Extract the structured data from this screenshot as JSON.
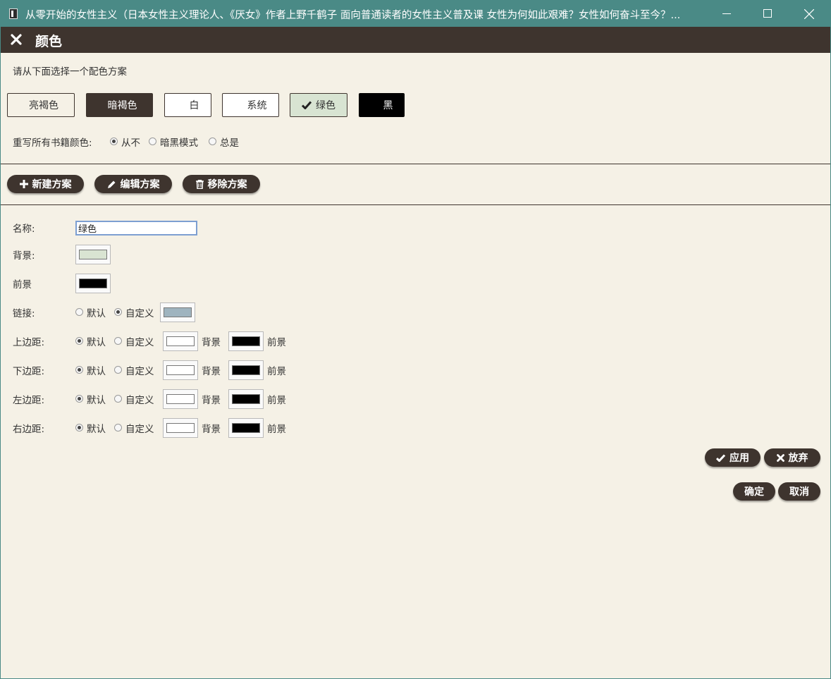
{
  "window": {
    "title": "从零开始的女性主义（日本女性主义理论人、《厌女》作者上野千鹤子 面向普通读者的女性主义普及课 女性为何如此艰难？女性如何奋斗至今？..."
  },
  "dialog": {
    "title": "颜色"
  },
  "schemes": {
    "prompt": "请从下面选择一个配色方案",
    "items": [
      {
        "label": "亮褐色",
        "bg": "#f5f1e6",
        "fg": "#333333"
      },
      {
        "label": "暗褐色",
        "bg": "#3e342e",
        "fg": "#ffffff"
      },
      {
        "label": "白",
        "bg": "#ffffff",
        "fg": "#333333"
      },
      {
        "label": "系统",
        "bg": "#ffffff",
        "fg": "#333333"
      },
      {
        "label": "绿色",
        "bg": "#d8e4d2",
        "fg": "#333333",
        "selected": true
      },
      {
        "label": "黑",
        "bg": "#000000",
        "fg": "#ffffff"
      }
    ]
  },
  "override": {
    "label": "重写所有书籍颜色:",
    "options": [
      {
        "label": "从不",
        "checked": true
      },
      {
        "label": "暗黑模式",
        "checked": false
      },
      {
        "label": "总是",
        "checked": false
      }
    ]
  },
  "scheme_actions": {
    "new_label": "新建方案",
    "edit_label": "编辑方案",
    "remove_label": "移除方案"
  },
  "form": {
    "name_label": "名称:",
    "name_value": "绿色",
    "background_label": "背景:",
    "background_color": "#d9e4d2",
    "foreground_label": "前景",
    "foreground_color": "#000000",
    "link_label": "链接:",
    "link_color": "#9fb4bf",
    "default_label": "默认",
    "custom_label": "自定义",
    "bg_word": "背景",
    "fg_word": "前景",
    "margins": [
      {
        "label": "上边距:",
        "bg": "#ffffff",
        "fg": "#000000"
      },
      {
        "label": "下边距:",
        "bg": "#ffffff",
        "fg": "#000000"
      },
      {
        "label": "左边距:",
        "bg": "#ffffff",
        "fg": "#000000"
      },
      {
        "label": "右边距:",
        "bg": "#ffffff",
        "fg": "#000000"
      }
    ]
  },
  "buttons": {
    "apply_label": "应用",
    "discard_label": "放弃",
    "ok_label": "确定",
    "cancel_label": "取消"
  },
  "colors": {
    "titlebar": "#4a8a86",
    "header": "#3e342e",
    "background": "#f5f1e6"
  }
}
